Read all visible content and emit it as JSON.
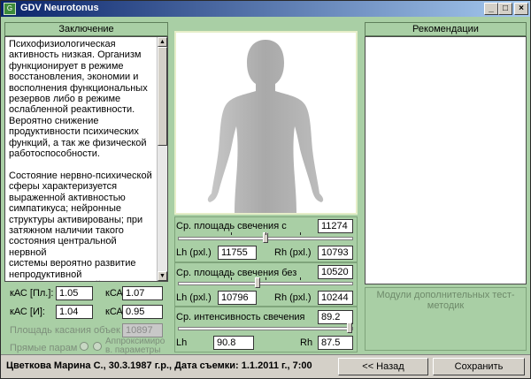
{
  "window": {
    "title": "GDV Neurotonus"
  },
  "conclusion": {
    "title": "Заключение",
    "text": "Психофизиологическая\nактивность низкая. Организм\nфункционирует в режиме\nвосстановления, экономии и\nвосполнения функциональных\nрезервов либо в режиме\nослабленной реактивности.\nВероятно снижение\nпродуктивности психических\nфункций, а так же физической\nработоспособности.\n\nСостояние нервно-психической\nсферы характеризуется\nвыраженной активностью\nсимпатикуса; нейронные\nструктуры активированы; при\nзатяжном наличии такого\nсостояния центральной нервной\nсистемы вероятно развитие\nнепродуктивной\nнервно-психической\nнапряжённости, с повышенным"
  },
  "coefficients": {
    "kas_pl_label": "кАС [Пл.]:",
    "kas_pl_value": "1.05",
    "ksa_pl_label": "кСА",
    "ksa_pl_value": "1.07",
    "kas_i_label": "кАС [И]:",
    "kas_i_value": "1.04",
    "ksa_i_label": "кСА",
    "ksa_i_value": "0.95",
    "contact_area_label": "Площадь касания объек",
    "contact_area_value": "10897",
    "direct_params_label": "Прямые парам",
    "approx_params_label": "Аппроксимиро в. параметры"
  },
  "metrics": {
    "avg_area_with": {
      "label": "Ср. площадь свечения с",
      "value": "11274",
      "lh_label": "Lh (pxl.)",
      "lh_value": "11755",
      "rh_label": "Rh (pxl.)",
      "rh_value": "10793",
      "slider_level": 0.5
    },
    "avg_area_without": {
      "label": "Ср. площадь свечения без",
      "value": "10520",
      "lh_label": "Lh (pxl.)",
      "lh_value": "10796",
      "rh_label": "Rh (pxl.)",
      "rh_value": "10244",
      "slider_level": 0.45
    },
    "avg_intensity": {
      "label": "Ср. интенсивность свечения",
      "value": "89.2",
      "lh_label": "Lh",
      "lh_value": "90.8",
      "rh_label": "Rh",
      "rh_value": "87.5",
      "slider_level": 1.0
    }
  },
  "recommendations": {
    "title": "Рекомендации",
    "text": "",
    "modules_text": "Модули дополнительных тест-методик"
  },
  "statusbar": {
    "text": "Цветкова Марина С., 30.3.1987 г.р., Дата съемки: 1.1.2011 г., 7:00",
    "back_label": "<< Назад",
    "save_label": "Сохранить"
  },
  "colors": {
    "panel_bg": "#a9cfa5",
    "titlebar": "#0a246a"
  }
}
